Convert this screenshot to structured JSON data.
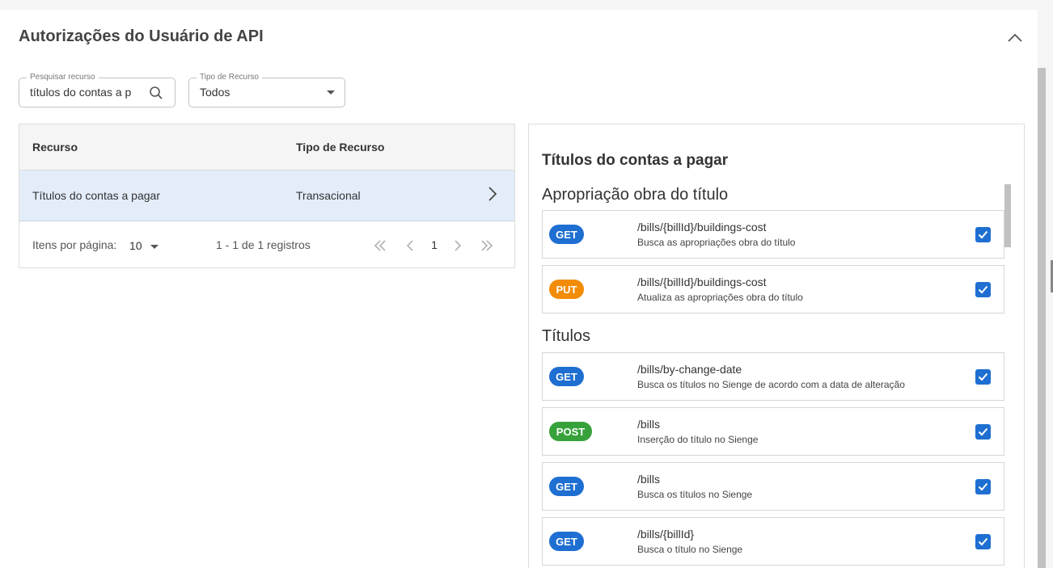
{
  "panel": {
    "title": "Autorizações do Usuário de API",
    "collapse_icon": "chevron-up-icon"
  },
  "filters": {
    "search": {
      "label": "Pesquisar recurso",
      "value": "títulos do contas a p",
      "icon": "search-icon"
    },
    "type": {
      "label": "Tipo de Recurso",
      "value": "Todos",
      "icon": "dropdown-arrow-icon"
    }
  },
  "table": {
    "columns": [
      "Recurso",
      "Tipo de Recurso"
    ],
    "rows": [
      {
        "resource": "Títulos do contas a pagar",
        "type": "Transacional"
      }
    ],
    "pager": {
      "items_per_page_label": "Itens por página:",
      "items_per_page": "10",
      "range": "1 - 1 de 1 registros",
      "current_page": "1"
    }
  },
  "detail": {
    "title": "Títulos do contas a pagar",
    "groups": [
      {
        "title": "Apropriação obra do título",
        "endpoints": [
          {
            "method": "GET",
            "path": "/bills/{billId}/buildings-cost",
            "description": "Busca as apropriações obra do título",
            "checked": true
          },
          {
            "method": "PUT",
            "path": "/bills/{billId}/buildings-cost",
            "description": "Atualiza as apropriações obra do título",
            "checked": true
          }
        ]
      },
      {
        "title": "Títulos",
        "endpoints": [
          {
            "method": "GET",
            "path": "/bills/by-change-date",
            "description": "Busca os títulos no Sienge de acordo com a data de alteração",
            "checked": true
          },
          {
            "method": "POST",
            "path": "/bills",
            "description": "Inserção do título no Sienge",
            "checked": true
          },
          {
            "method": "GET",
            "path": "/bills",
            "description": "Busca os títulos no Sienge",
            "checked": true
          },
          {
            "method": "GET",
            "path": "/bills/{billId}",
            "description": "Busca o título no Sienge",
            "checked": true
          }
        ]
      }
    ]
  },
  "colors": {
    "get": "#1e6fd1",
    "put": "#f28b06",
    "post": "#37a23b",
    "selected_row": "#e3edf9",
    "checkbox": "#1e6fd1"
  }
}
